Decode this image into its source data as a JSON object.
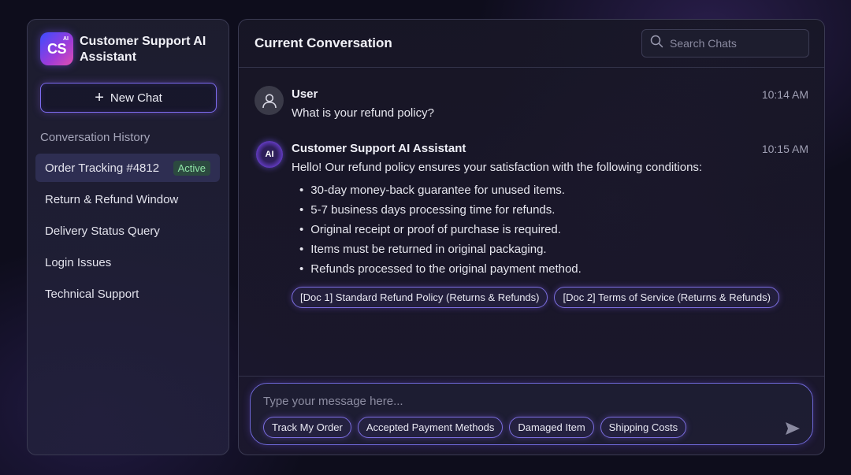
{
  "sidebar": {
    "logo_text": "CS",
    "logo_badge": "AI",
    "app_title": "Customer Support AI Assistant",
    "new_chat_label": "New Chat",
    "history_heading": "Conversation History",
    "items": [
      {
        "label": "Order Tracking #4812",
        "badge": "Active",
        "active": true
      },
      {
        "label": "Return & Refund Window"
      },
      {
        "label": "Delivery Status Query"
      },
      {
        "label": "Login Issues"
      },
      {
        "label": "Technical Support"
      }
    ]
  },
  "header": {
    "title": "Current Conversation",
    "search_placeholder": "Search Chats"
  },
  "messages": [
    {
      "sender": "User",
      "time": "10:14 AM",
      "text": "What is your refund policy?"
    },
    {
      "sender": "Customer Support AI Assistant",
      "avatar_text": "AI",
      "time": "10:15 AM",
      "text": "Hello! Our refund policy ensures your satisfaction with the following conditions:",
      "bullets": [
        "30-day money-back guarantee for unused items.",
        "5-7 business days processing time for refunds.",
        "Original receipt or proof of purchase is required.",
        "Items must be returned in original packaging.",
        "Refunds processed to the original payment method."
      ],
      "sources": [
        "[Doc 1] Standard Refund Policy (Returns & Refunds)",
        "[Doc 2] Terms of Service (Returns & Refunds)"
      ]
    }
  ],
  "composer": {
    "placeholder": "Type your message here...",
    "suggestions": [
      "Track My Order",
      "Accepted Payment Methods",
      "Damaged Item",
      "Shipping Costs"
    ]
  },
  "icons": {
    "search": "search-icon",
    "user_avatar": "user-icon",
    "send": "send-icon",
    "plus": "plus-icon"
  },
  "colors": {
    "accent": "#7d6cf0",
    "active_badge": "#8fe3a6",
    "background": "#0e0d1c"
  }
}
